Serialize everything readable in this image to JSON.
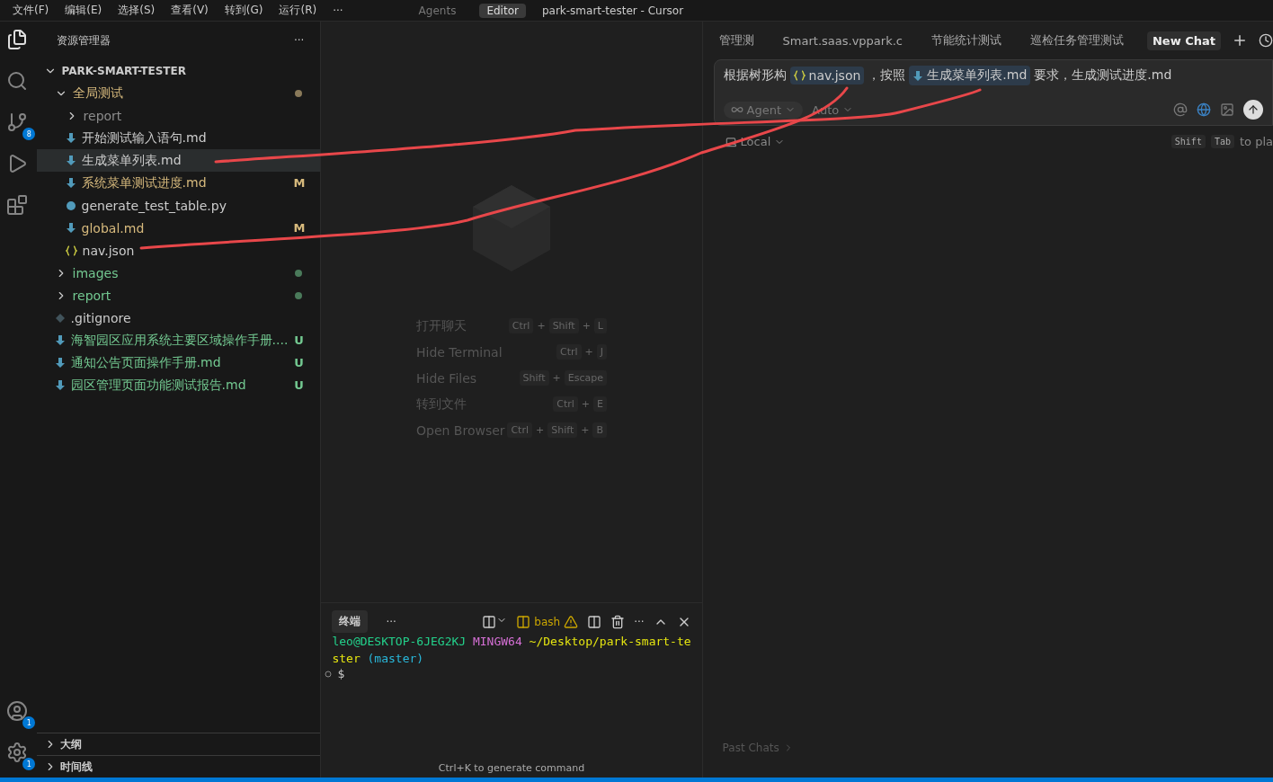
{
  "menu": [
    "文件(F)",
    "编辑(E)",
    "选择(S)",
    "查看(V)",
    "转到(G)",
    "运行(R)",
    "···"
  ],
  "mode_tabs": [
    {
      "label": "Agents",
      "selected": false
    },
    {
      "label": "Editor",
      "selected": true
    }
  ],
  "window": {
    "title": "park-smart-tester - Cursor"
  },
  "activity_bar": {
    "items": [
      {
        "kind": "files",
        "selected": true
      },
      {
        "kind": "search",
        "selected": false
      },
      {
        "kind": "scm",
        "selected": false,
        "badge": "8"
      },
      {
        "kind": "debug",
        "selected": false
      },
      {
        "kind": "extensions",
        "selected": false
      }
    ],
    "bottom": [
      {
        "kind": "account",
        "badge": "1"
      },
      {
        "kind": "settings",
        "badge": "1"
      }
    ]
  },
  "explorer": {
    "title": "资源管理器",
    "more": "···",
    "project": "PARK-SMART-TESTER",
    "tree": [
      {
        "kind": "folder",
        "name": "全局测试",
        "expanded": true,
        "color": "#d7ba7d",
        "dot": {
          "color": "#8a7a5a"
        },
        "children": [
          {
            "kind": "folder",
            "name": "report",
            "expanded": false,
            "color": "#8c8c8c"
          },
          {
            "kind": "md",
            "name": "开始测试输入语句.md",
            "color": "#cccccc",
            "selected": false
          },
          {
            "kind": "md",
            "name": "生成菜单列表.md",
            "color": "#cccccc",
            "selected": true
          },
          {
            "kind": "md",
            "name": "系统菜单测试进度.md",
            "color": "#d7ba7d",
            "badge": "M",
            "selected": false
          },
          {
            "kind": "py",
            "name": "generate_test_table.py",
            "color": "#cccccc",
            "selected": false
          },
          {
            "kind": "md",
            "name": "global.md",
            "color": "#d7ba7d",
            "badge": "M",
            "selected": false
          },
          {
            "kind": "json",
            "name": "nav.json",
            "color": "#cccccc",
            "selected": false
          }
        ]
      },
      {
        "kind": "folder",
        "name": "images",
        "expanded": false,
        "color": "#73c991",
        "dot": {
          "color": "#4a7a5a"
        }
      },
      {
        "kind": "folder",
        "name": "report",
        "expanded": false,
        "color": "#73c991",
        "dot": {
          "color": "#4a7a5a"
        }
      },
      {
        "kind": "git",
        "name": ".gitignore",
        "color": "#cccccc",
        "selected": false
      },
      {
        "kind": "md",
        "name": "海智园区应用系统主要区域操作手册....",
        "color": "#73c991",
        "badge": "U",
        "selected": false
      },
      {
        "kind": "md",
        "name": "通知公告页面操作手册.md",
        "color": "#73c991",
        "badge": "U",
        "selected": false
      },
      {
        "kind": "md",
        "name": "园区管理页面功能测试报告.md",
        "color": "#73c991",
        "badge": "U",
        "selected": false
      }
    ],
    "sections": [
      "大纲",
      "时间线"
    ]
  },
  "shortcuts": [
    {
      "label": "打开聊天",
      "keys": [
        {
          "kind": "key",
          "text": "Ctrl"
        },
        {
          "kind": "plus",
          "text": "+"
        },
        {
          "kind": "key",
          "text": "Shift"
        },
        {
          "kind": "plus",
          "text": "+"
        },
        {
          "kind": "key",
          "text": "L"
        }
      ]
    },
    {
      "label": "Hide Terminal",
      "keys": [
        {
          "kind": "key",
          "text": "Ctrl"
        },
        {
          "kind": "plus",
          "text": "+"
        },
        {
          "kind": "key",
          "text": "J"
        }
      ]
    },
    {
      "label": "Hide Files",
      "keys": [
        {
          "kind": "key",
          "text": "Shift"
        },
        {
          "kind": "plus",
          "text": "+"
        },
        {
          "kind": "key",
          "text": "Escape"
        }
      ]
    },
    {
      "label": "转到文件",
      "keys": [
        {
          "kind": "key",
          "text": "Ctrl"
        },
        {
          "kind": "plus",
          "text": "+"
        },
        {
          "kind": "key",
          "text": "E"
        }
      ]
    },
    {
      "label": "Open Browser",
      "keys": [
        {
          "kind": "key",
          "text": "Ctrl"
        },
        {
          "kind": "plus",
          "text": "+"
        },
        {
          "kind": "key",
          "text": "Shift"
        },
        {
          "kind": "plus",
          "text": "+"
        },
        {
          "kind": "key",
          "text": "B"
        }
      ]
    }
  ],
  "terminal": {
    "tab": "终端",
    "more": "···",
    "shell": "bash",
    "more2": "···",
    "lines": [
      [
        {
          "text": "leo@DESKTOP-6JEG2KJ",
          "color": "#23d18b"
        },
        {
          "text": "MINGW64",
          "color": "#d670d6"
        },
        {
          "text": "~/Desktop/park-smart-te",
          "color": "#e5e510"
        }
      ],
      [
        {
          "text": "ster",
          "color": "#e5e510"
        },
        {
          "text": "(master)",
          "color": "#29b8db"
        }
      ]
    ],
    "prompt": "$",
    "hint": "Ctrl+K to generate command"
  },
  "chat": {
    "tabs": [
      {
        "label": "管理测",
        "selected": false
      },
      {
        "label": "Smart.saas.vppark.c",
        "selected": false
      },
      {
        "label": "节能统计测试",
        "selected": false
      },
      {
        "label": "巡检任务管理测试",
        "selected": false
      },
      {
        "label": "New Chat",
        "selected": true
      }
    ],
    "input": [
      {
        "kind": "text",
        "text": "根据树形构"
      },
      {
        "kind": "json",
        "text": "nav.json"
      },
      {
        "kind": "text",
        "text": "，按照"
      },
      {
        "kind": "md",
        "text": "生成菜单列表.md"
      },
      {
        "kind": "text",
        "text": "要求，生成测试进度.md"
      }
    ],
    "mode": "Agent",
    "model": "Auto",
    "location": "Local",
    "keys": [
      "Shift",
      "Tab"
    ],
    "keys_hint": "to pla",
    "past": "Past Chats"
  }
}
